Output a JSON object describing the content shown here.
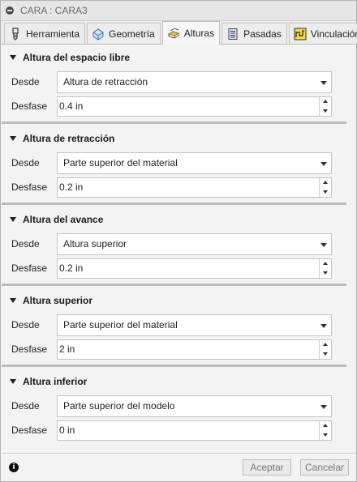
{
  "window": {
    "title": "CARA : CARA3"
  },
  "tabs": [
    {
      "label": "Herramienta",
      "icon": "tool-icon"
    },
    {
      "label": "Geometría",
      "icon": "geometry-icon"
    },
    {
      "label": "Alturas",
      "icon": "heights-icon",
      "active": true
    },
    {
      "label": "Pasadas",
      "icon": "passes-icon"
    },
    {
      "label": "Vinculación",
      "icon": "linking-icon"
    }
  ],
  "sections": [
    {
      "title": "Altura del espacio libre",
      "desde_label": "Desde",
      "desde_value": "Altura de retracción",
      "desfase_label": "Desfase",
      "desfase_value": "0.4 in"
    },
    {
      "title": "Altura de retracción",
      "desde_label": "Desde",
      "desde_value": "Parte superior del material",
      "desfase_label": "Desfase",
      "desfase_value": "0.2 in"
    },
    {
      "title": "Altura del avance",
      "desde_label": "Desde",
      "desde_value": "Altura superior",
      "desfase_label": "Desfase",
      "desfase_value": "0.2 in"
    },
    {
      "title": "Altura superior",
      "desde_label": "Desde",
      "desde_value": "Parte superior del material",
      "desfase_label": "Desfase",
      "desfase_value": "2 in"
    },
    {
      "title": "Altura inferior",
      "desde_label": "Desde",
      "desde_value": "Parte superior del modelo",
      "desfase_label": "Desfase",
      "desfase_value": "0 in"
    }
  ],
  "footer": {
    "ok_label": "Aceptar",
    "cancel_label": "Cancelar",
    "info_icon": "info-icon"
  }
}
